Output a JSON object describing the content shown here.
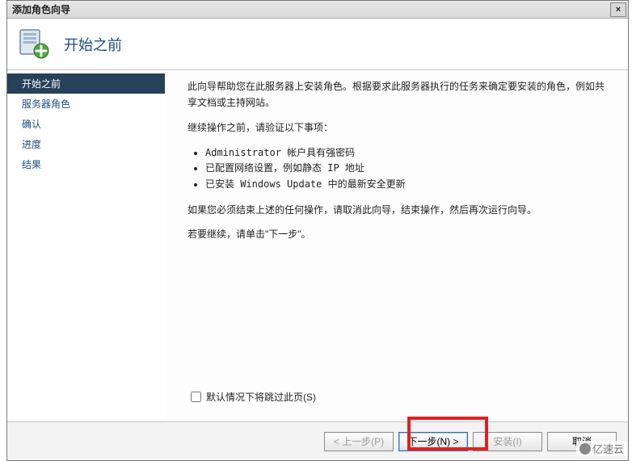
{
  "window": {
    "title": "添加角色向导",
    "close_label": "×"
  },
  "header": {
    "title": "开始之前"
  },
  "sidebar": {
    "items": [
      {
        "label": "开始之前",
        "active": true
      },
      {
        "label": "服务器角色",
        "active": false
      },
      {
        "label": "确认",
        "active": false
      },
      {
        "label": "进度",
        "active": false
      },
      {
        "label": "结果",
        "active": false
      }
    ]
  },
  "content": {
    "intro": "此向导帮助您在此服务器上安装角色。根据要求此服务器执行的任务来确定要安装的角色，例如共享文档或主持网站。",
    "verify_heading": "继续操作之前，请验证以下事项：",
    "verify_items": [
      "Administrator 帐户具有强密码",
      "已配置网络设置，例如静态 IP 地址",
      "已安装 Windows Update 中的最新安全更新"
    ],
    "cancel_hint": "如果您必须结束上述的任何操作，请取消此向导，结束操作，然后再次运行向导。",
    "continue_hint": "若要继续，请单击\"下一步\"。",
    "skip_checkbox": "默认情况下将跳过此页(S)"
  },
  "footer": {
    "prev": "< 上一步(P)",
    "next": "下一步(N) >",
    "install": "安装(I)",
    "cancel": "取消"
  },
  "watermark": "亿速云"
}
